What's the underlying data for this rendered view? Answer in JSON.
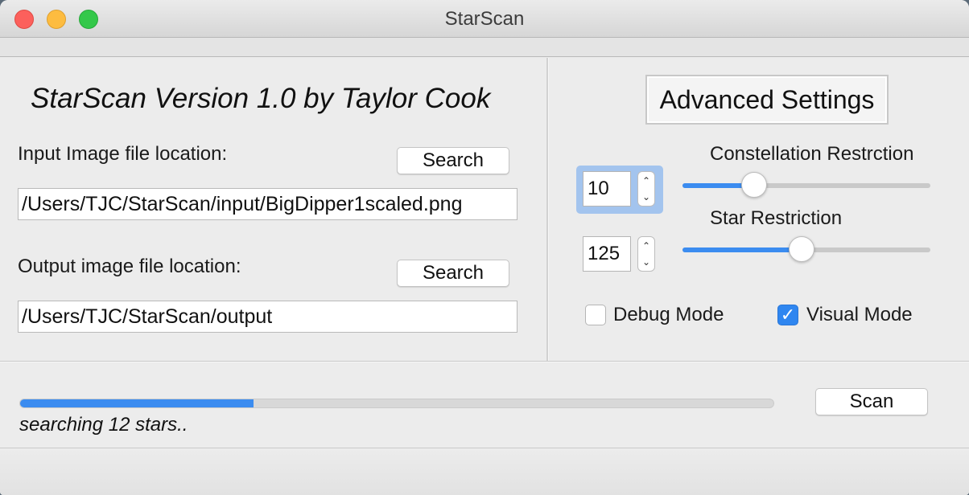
{
  "window": {
    "title": "StarScan"
  },
  "left_panel": {
    "heading": "StarScan Version 1.0 by Taylor Cook",
    "input_label": "Input Image file location:",
    "input_search_label": "Search",
    "input_path": "/Users/TJC/StarScan/input/BigDipper1scaled.png",
    "output_label": "Output image file location:",
    "output_search_label": "Search",
    "output_path": "/Users/TJC/StarScan/output"
  },
  "right_panel": {
    "advanced_label": "Advanced Settings",
    "constellation": {
      "label": "Constellation Restrction",
      "value": "10",
      "slider_fraction": 0.29
    },
    "star": {
      "label": "Star Restriction",
      "value": "125",
      "slider_fraction": 0.48
    },
    "debug_mode": {
      "label": "Debug Mode",
      "checked": false
    },
    "visual_mode": {
      "label": "Visual Mode",
      "checked": true
    }
  },
  "bottom": {
    "progress_fraction": 0.31,
    "status_text": "searching 12 stars..",
    "scan_label": "Scan"
  },
  "colors": {
    "accent": "#3b8cf0",
    "focus_ring": "#a3c4ee"
  },
  "icons": {
    "stepper_up": "chevron-up-icon",
    "stepper_down": "chevron-down-icon",
    "check": "checkmark-icon"
  }
}
